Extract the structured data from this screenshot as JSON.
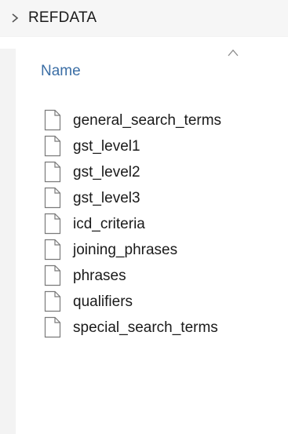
{
  "breadcrumb": {
    "folder_name": "REFDATA"
  },
  "columns": {
    "name_header": "Name",
    "sort_direction": "ascending"
  },
  "files": [
    {
      "name": "general_search_terms",
      "icon": "document-icon"
    },
    {
      "name": "gst_level1",
      "icon": "document-icon"
    },
    {
      "name": "gst_level2",
      "icon": "document-icon"
    },
    {
      "name": "gst_level3",
      "icon": "document-icon"
    },
    {
      "name": "icd_criteria",
      "icon": "document-icon"
    },
    {
      "name": "joining_phrases",
      "icon": "document-icon"
    },
    {
      "name": "phrases",
      "icon": "document-icon"
    },
    {
      "name": "qualifiers",
      "icon": "document-icon"
    },
    {
      "name": "special_search_terms",
      "icon": "document-icon"
    }
  ],
  "colors": {
    "header_text": "#3b6ea5",
    "text": "#1a1a1a",
    "bar_background": "#f6f6f6"
  }
}
